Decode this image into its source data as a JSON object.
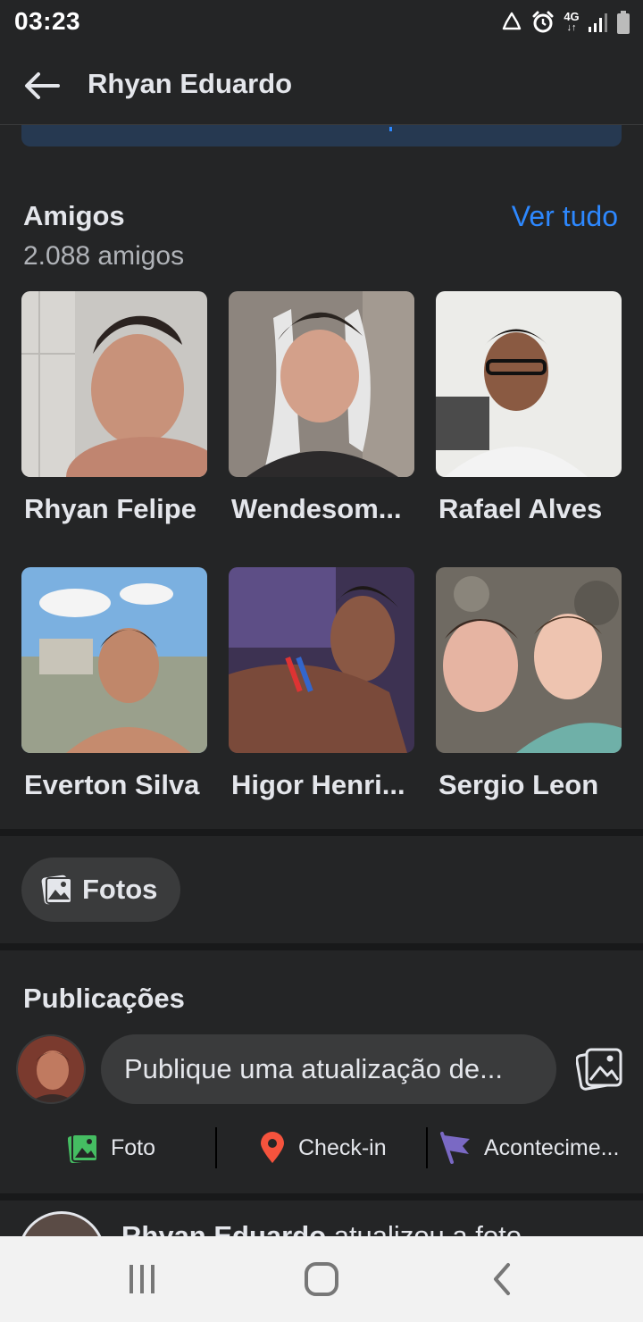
{
  "status_bar": {
    "time": "03:23",
    "network": "4G",
    "icons": [
      "recycle-icon",
      "alarm-icon",
      "network-4g-icon",
      "signal-icon",
      "battery-icon"
    ]
  },
  "app_bar": {
    "title": "Rhyan Eduardo",
    "back_icon": "arrow-left-icon"
  },
  "friends": {
    "title": "Amigos",
    "count": "2.088 amigos",
    "see_all": "Ver tudo",
    "items": [
      {
        "name": "Rhyan Felipe"
      },
      {
        "name": "Wendesom..."
      },
      {
        "name": "Rafael Alves"
      },
      {
        "name": "Everton Silva"
      },
      {
        "name": "Higor Henri..."
      },
      {
        "name": "Sergio Leon"
      }
    ]
  },
  "photos": {
    "label": "Fotos",
    "icon": "photos-icon"
  },
  "posts": {
    "title": "Publicações",
    "composer_placeholder": "Publique uma atualização de...",
    "actions": [
      {
        "label": "Foto",
        "icon": "photo-icon",
        "color": "#45bd62"
      },
      {
        "label": "Check-in",
        "icon": "location-pin-icon",
        "color": "#f5533d"
      },
      {
        "label": "Acontecime...",
        "icon": "flag-icon",
        "color": "#7a69c4"
      }
    ]
  },
  "post": {
    "author": "Rhyan Eduardo",
    "action_text": " atualizou a foto"
  },
  "nav_bar": {
    "icons": [
      "recent-apps-icon",
      "home-icon",
      "back-icon"
    ]
  },
  "colors": {
    "background": "#18191a",
    "surface": "#242526",
    "link": "#2d88ff",
    "text": "#e4e6eb",
    "secondary_text": "#b0b3b8"
  }
}
